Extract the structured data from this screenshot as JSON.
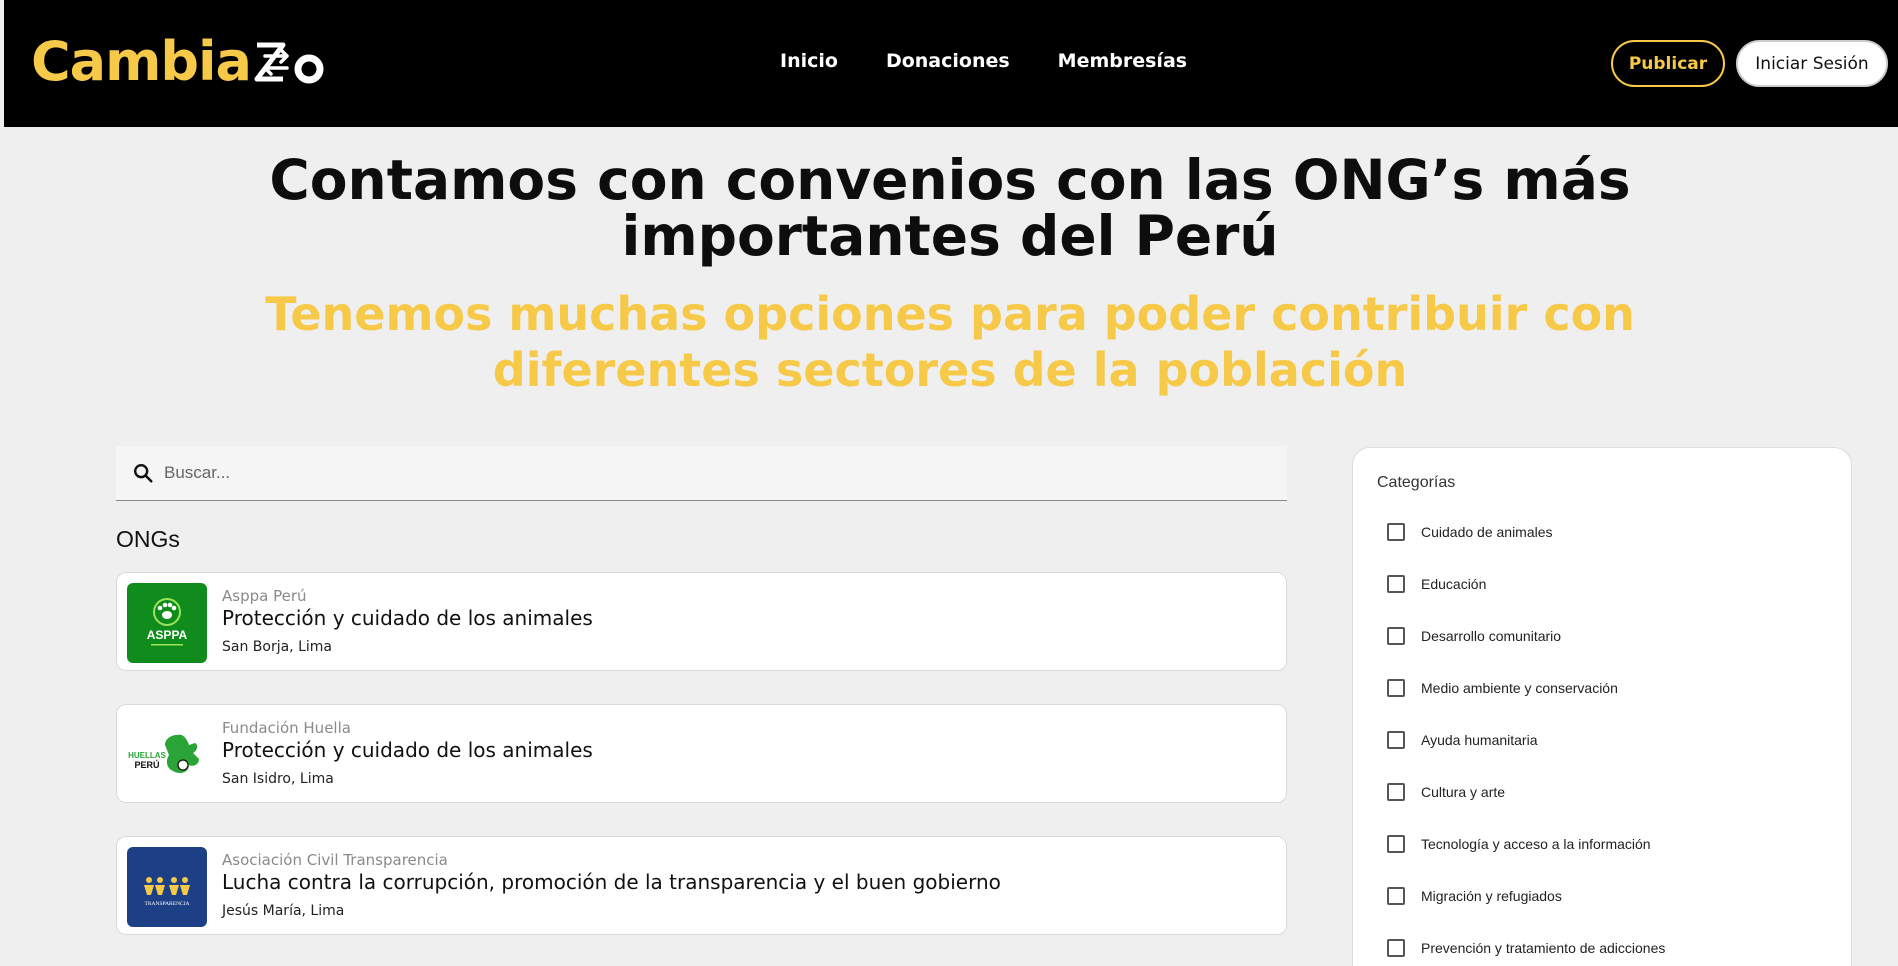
{
  "brand": {
    "logo_text": "Cambia",
    "logo_suffix": "o",
    "accent": "#f7c948"
  },
  "nav": {
    "items": [
      "Inicio",
      "Donaciones",
      "Membresías"
    ]
  },
  "header": {
    "publish_label": "Publicar",
    "login_label": "Iniciar Sesión"
  },
  "hero": {
    "title_line1": "Contamos con convenios con las ONG’s más",
    "title_line2": "importantes del Perú",
    "subtitle_line1": "Tenemos muchas opciones para poder contribuir con",
    "subtitle_line2": "diferentes sectores de la población"
  },
  "search": {
    "placeholder": "Buscar..."
  },
  "list": {
    "title": "ONGs",
    "items": [
      {
        "org": "Asppa Perú",
        "cause": "Protección y cuidado de los animales",
        "location": "San Borja, Lima",
        "logo_text": "ASPPA",
        "logo_color": "#0f8c1b"
      },
      {
        "org": "Fundación Huella",
        "cause": "Protección y cuidado de los animales",
        "location": "San Isidro, Lima",
        "logo_text": "HUELLAS PERÚ",
        "logo_color": "#ffffff"
      },
      {
        "org": "Asociación Civil Transparencia",
        "cause": "Lucha contra la corrupción, promoción de la transparencia y el buen gobierno",
        "location": "Jesús María, Lima",
        "logo_text": "TRANSPARENCIA",
        "logo_color": "#1c3f86"
      }
    ]
  },
  "categories": {
    "title": "Categorías",
    "items": [
      "Cuidado de animales",
      "Educación",
      "Desarrollo comunitario",
      "Medio ambiente y conservación",
      "Ayuda humanitaria",
      "Cultura y arte",
      "Tecnología y acceso a la información",
      "Migración y refugiados",
      "Prevención y tratamiento de adicciones"
    ]
  }
}
